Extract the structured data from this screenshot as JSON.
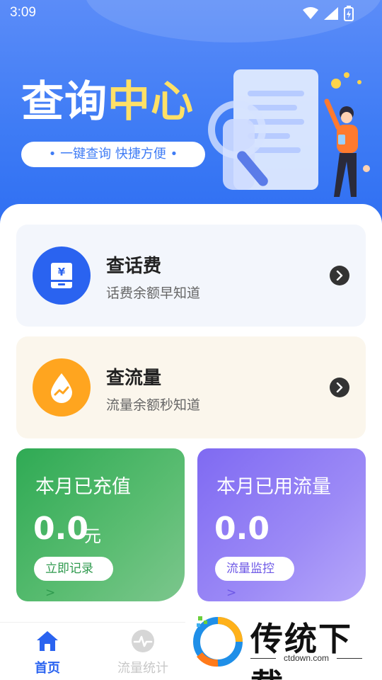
{
  "status_bar": {
    "time": "3:09"
  },
  "hero": {
    "title_part1": "查询",
    "title_part2": "中心",
    "tagline": "• 一键查询  快捷方便 •"
  },
  "cards": [
    {
      "title": "查话费",
      "subtitle": "话费余额早知道",
      "icon": "yen-wallet-icon"
    },
    {
      "title": "查流量",
      "subtitle": "流量余额秒知道",
      "icon": "water-drop-icon"
    }
  ],
  "stats": [
    {
      "title": "本月已充值",
      "value": "0.0",
      "unit": "元",
      "button": "立即记录 >"
    },
    {
      "title": "本月已用流量",
      "value": "0.0",
      "button": "流量监控 >"
    }
  ],
  "tabbar": {
    "items": [
      {
        "label": "首页",
        "icon": "home-icon",
        "active": true
      },
      {
        "label": "流量统计",
        "icon": "pulse-icon",
        "active": false
      }
    ]
  },
  "watermark": {
    "brand": "传统下载",
    "url": "ctdown.com"
  },
  "colors": {
    "primary": "#2a63f0",
    "hero_bg": "#3f7cf5",
    "accent_yellow": "#ffe066",
    "orange": "#ffa51f",
    "green": "#2faa54",
    "purple": "#7f6af2"
  }
}
